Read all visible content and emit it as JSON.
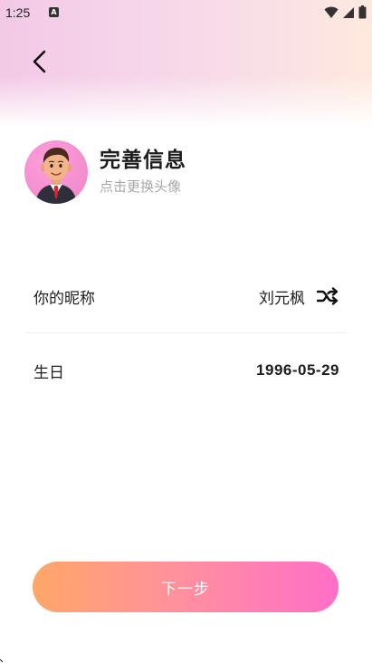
{
  "status_bar": {
    "time": "1:25",
    "notification_icon": "a-notification-icon",
    "wifi_icon": "wifi-icon",
    "signal_icon": "signal-icon",
    "battery_icon": "battery-icon"
  },
  "header": {
    "back_icon": "chevron-left-icon"
  },
  "profile": {
    "title": "完善信息",
    "subtitle": "点击更换头像",
    "avatar": "avatar"
  },
  "nickname": {
    "label": "你的昵称",
    "value": "刘元枫",
    "shuffle_icon": "shuffle-icon"
  },
  "birthday": {
    "label": "生日",
    "value": "1996-05-29"
  },
  "footer": {
    "next_label": "下一步"
  },
  "colors": {
    "button_start": "#ffa768",
    "button_end": "#ff6ec8",
    "avatar_bg": "#f58fd0",
    "subtitle": "#a8a8a8"
  }
}
